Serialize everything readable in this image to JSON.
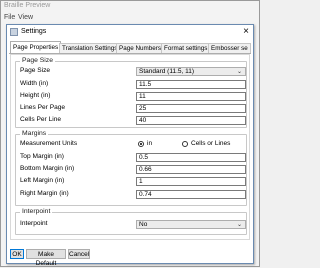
{
  "app": {
    "title": "Braille Preview"
  },
  "menubar": {
    "items": [
      "File",
      "View"
    ]
  },
  "dialog": {
    "title": "Settings",
    "close_glyph": "×",
    "tabs": [
      "Page Properties",
      "Translation Settings",
      "Page Numbers",
      "Format settings",
      "Embosser se"
    ]
  },
  "page_size_group": {
    "title": "Page Size",
    "page_size_label": "Page Size",
    "page_size_value": "Standard (11.5, 11)",
    "width_label": "Width (in)",
    "width_value": "11.5",
    "height_label": "Height (in)",
    "height_value": "11",
    "lines_label": "Lines Per Page",
    "lines_value": "25",
    "cells_label": "Cells Per Line",
    "cells_value": "40"
  },
  "margins_group": {
    "title": "Margins",
    "units_label": "Measurement Units",
    "unit_in": "in",
    "unit_cells": "Cells or Lines",
    "selected_unit": "in",
    "top_label": "Top Margin (in)",
    "top_value": "0.5",
    "bottom_label": "Bottom Margin (in)",
    "bottom_value": "0.66",
    "left_label": "Left Margin (in)",
    "left_value": "1",
    "right_label": "Right Margin (in)",
    "right_value": "0.74"
  },
  "interpoint_group": {
    "title": "Interpoint",
    "label": "Interpoint",
    "value": "No"
  },
  "buttons": {
    "ok": "OK",
    "make_default": "Make Default",
    "cancel": "Cancel"
  }
}
